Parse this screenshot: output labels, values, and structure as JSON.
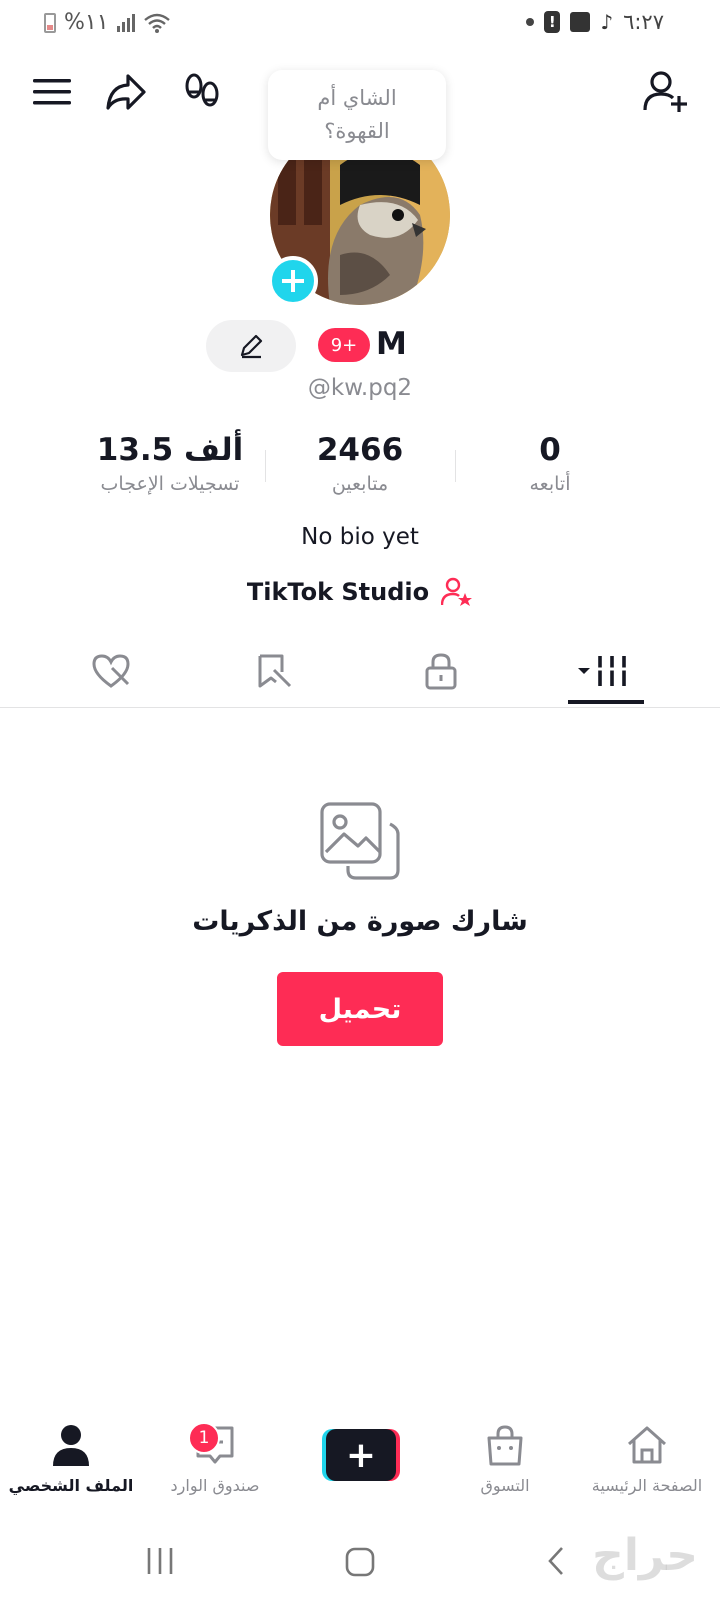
{
  "status_bar": {
    "battery_text": "%١١",
    "time": "٦:٢٧"
  },
  "bubble": {
    "line1": "الشاي أم",
    "line2": "القهوة؟"
  },
  "profile": {
    "name": "M",
    "notification_badge": "9+",
    "handle": "@kw.pq2",
    "bio": "No bio yet",
    "studio_label": "TikTok Studio"
  },
  "stats": {
    "likes": {
      "value": "13.5 ألف",
      "label": "تسجيلات الإعجاب"
    },
    "followers": {
      "value": "2466",
      "label": "متابعين"
    },
    "following": {
      "value": "0",
      "label": "أتابعه"
    }
  },
  "tabs": [
    {
      "name": "videos",
      "icon": "grid-icon",
      "active": true
    },
    {
      "name": "private",
      "icon": "lock-icon",
      "active": false
    },
    {
      "name": "saved",
      "icon": "bookmark-hidden-icon",
      "active": false
    },
    {
      "name": "liked",
      "icon": "heart-hidden-icon",
      "active": false
    }
  ],
  "empty_state": {
    "title": "شارك صورة من الذكريات",
    "button": "تحميل"
  },
  "bottom_nav": {
    "home": "الصفحة الرئيسية",
    "shop": "التسوق",
    "inbox": "صندوق الوارد",
    "inbox_badge": "1",
    "profile": "الملف الشخصي"
  },
  "watermark": "حراج",
  "colors": {
    "accent": "#fe2c55",
    "cyan": "#20d5ec",
    "text": "#161823",
    "muted": "#8a8b91"
  }
}
